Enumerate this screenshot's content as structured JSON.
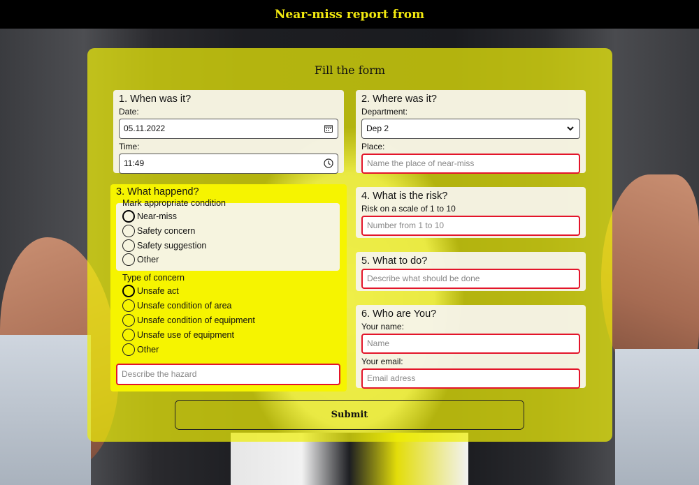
{
  "header": {
    "title": "Near-miss report from"
  },
  "form": {
    "title": "Fill the form",
    "when": {
      "heading": "1. When was it?",
      "date_label": "Date:",
      "date_value": "05.11.2022",
      "time_label": "Time:",
      "time_value": "11:49"
    },
    "where": {
      "heading": "2. Where was it?",
      "department_label": "Department:",
      "department_value": "Dep 2",
      "place_label": "Place:",
      "place_placeholder": "Name the place of near-miss"
    },
    "happened": {
      "heading": "3. What happend?",
      "condition_label": "Mark appropriate condition",
      "conditions": [
        "Near-miss",
        "Safety concern",
        "Safety suggestion",
        "Other"
      ],
      "concern_label": "Type of concern",
      "concerns": [
        "Unsafe act",
        "Unsafe condition of area",
        "Unsafe condition of equipment",
        "Unsafe use of equipment",
        "Other"
      ],
      "hazard_placeholder": "Describe the hazard"
    },
    "risk": {
      "heading": "4. What is the risk?",
      "scale_label": "Risk on a scale of 1 to 10",
      "placeholder": "Number from 1 to 10"
    },
    "todo": {
      "heading": "5. What to do?",
      "placeholder": "Describe what should be done"
    },
    "who": {
      "heading": "6. Who are You?",
      "name_label": "Your name:",
      "name_placeholder": "Name",
      "email_label": "Your email:",
      "email_placeholder": "Email adress"
    },
    "submit_label": "Submit"
  },
  "colors": {
    "header_bg": "#000000",
    "header_text": "#f2e90f",
    "panel": "#eeee08",
    "happened_card": "#f6f400",
    "required_border": "#e3152a"
  },
  "icons": [
    "calendar-icon",
    "clock-icon",
    "chevron-down-icon"
  ]
}
